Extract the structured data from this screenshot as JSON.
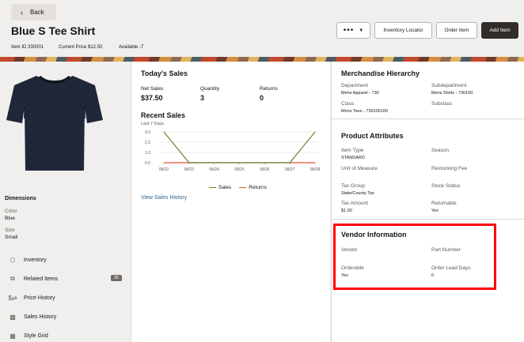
{
  "header": {
    "back_label": "Back",
    "title": "Blue S Tee Shirt",
    "item_id": "Item ID 330001",
    "current_price": "Current Price $12.50",
    "available": "Available -7",
    "buttons": {
      "more_label": "•••",
      "inventory_locator": "Inventory Locator",
      "order_item": "Order Item",
      "add_item": "Add Item"
    }
  },
  "left": {
    "dimensions_title": "Dimensions",
    "color_label": "Color",
    "color_value": "Blue",
    "size_label": "Size",
    "size_value": "Small",
    "nav": [
      {
        "label": "Inventory",
        "icon": "cube-icon"
      },
      {
        "label": "Related Items",
        "icon": "related-items-icon",
        "badge": "25"
      },
      {
        "label": "Price History",
        "icon": "price-history-icon"
      },
      {
        "label": "Sales History",
        "icon": "bar-chart-icon"
      },
      {
        "label": "Style Grid",
        "icon": "grid-icon"
      }
    ]
  },
  "today": {
    "title": "Today's Sales",
    "net_sales_label": "Net Sales",
    "net_sales_value": "$37.50",
    "quantity_label": "Quantity",
    "quantity_value": "3",
    "returns_label": "Returns",
    "returns_value": "0"
  },
  "recent": {
    "title": "Recent Sales",
    "subtitle": "Last 7 Days",
    "view_history": "View Sales History"
  },
  "chart_data": {
    "type": "line",
    "categories": [
      "08/22",
      "08/23",
      "08/24",
      "08/25",
      "08/26",
      "08/27",
      "08/28"
    ],
    "series": [
      {
        "name": "Sales",
        "values": [
          3.0,
          0.0,
          0.0,
          0.0,
          0.0,
          0.0,
          3.0
        ],
        "color": "#5a8a2a"
      },
      {
        "name": "Returns",
        "values": [
          0.0,
          0.0,
          0.0,
          0.0,
          0.0,
          0.0,
          0.0
        ],
        "color": "#e0523a"
      }
    ],
    "yticks": [
      "3.0",
      "2.0",
      "1.0",
      "0.0"
    ],
    "ylim": [
      0,
      3
    ],
    "legend": "bottom"
  },
  "merch": {
    "title": "Merchandise Hierarchy",
    "department_label": "Department",
    "department_value": "Mens Apparel - 730",
    "subdepartment_label": "Subdepartment",
    "subdepartment_value": "Mens Shirts - 730100",
    "class_label": "Class",
    "class_value": "Mens Tees - 730100100",
    "subclass_label": "Subclass"
  },
  "attributes": {
    "title": "Product Attributes",
    "item_type_label": "Item Type",
    "item_type_value": "STANDARD",
    "season_label": "Season",
    "uom_label": "Unit of Measure",
    "restocking_label": "Restocking Fee",
    "tax_group_label": "Tax Group",
    "tax_group_value": "State/County Tax",
    "stock_status_label": "Stock Status",
    "tax_amount_label": "Tax Amount",
    "tax_amount_value": "$1.00",
    "returnable_label": "Returnable",
    "returnable_value": "Yes"
  },
  "vendor": {
    "title": "Vendor Information",
    "vendor_label": "Vendor",
    "part_number_label": "Part Number",
    "orderable_label": "Orderable",
    "orderable_value": "Yes",
    "lead_days_label": "Order Lead Days",
    "lead_days_value": "0"
  },
  "colors": {
    "highlight": "#ff0000",
    "primary_button": "#312d2a",
    "link": "#2f5f8f"
  }
}
